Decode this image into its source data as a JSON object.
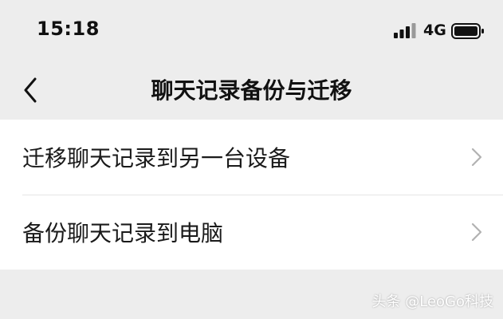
{
  "status_bar": {
    "time": "15:18",
    "network": "4G",
    "signal_icon": "cellular-signal-icon",
    "battery_icon": "battery-icon"
  },
  "nav": {
    "back_icon": "chevron-left-icon",
    "title": "聊天记录备份与迁移"
  },
  "menu": {
    "items": [
      {
        "label": "迁移聊天记录到另一台设备",
        "icon": "chevron-right-icon"
      },
      {
        "label": "备份聊天记录到电脑",
        "icon": "chevron-right-icon"
      }
    ]
  },
  "watermark": "头条 @LeoGo科技",
  "colors": {
    "background": "#ededed",
    "list_background": "#ffffff",
    "chevron": "#b2b2b2"
  }
}
